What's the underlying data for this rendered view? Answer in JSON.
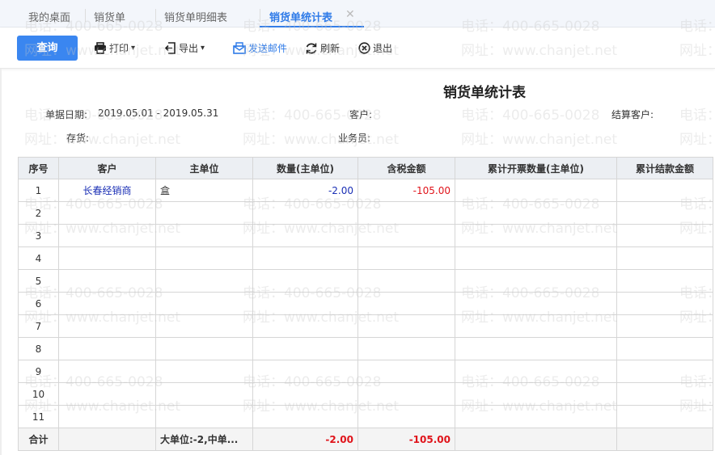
{
  "tabs": [
    "我的桌面",
    "销货单",
    "销货单明细表",
    "销货单统计表"
  ],
  "toolbar": {
    "query": "查询",
    "print": "打印",
    "export": "导出",
    "email": "发送邮件",
    "refresh": "刷新",
    "exit": "退出"
  },
  "report": {
    "title": "销货单统计表",
    "filters": {
      "date_label": "单据日期:",
      "date_value": "2019.05.01 - 2019.05.31",
      "customer_label": "客户:",
      "settle_label": "结算客户:",
      "stock_label": "存货:",
      "salesman_label": "业务员:"
    }
  },
  "table": {
    "headers": [
      "序号",
      "客户",
      "主单位",
      "数量(主单位)",
      "含税金额",
      "累计开票数量(主单位)",
      "累计结款金额"
    ],
    "rows": [
      [
        "1",
        "长春经销商",
        "盒",
        "-2.00",
        "-105.00",
        "",
        ""
      ],
      [
        "2",
        "",
        "",
        "",
        "",
        "",
        ""
      ],
      [
        "3",
        "",
        "",
        "",
        "",
        "",
        ""
      ],
      [
        "4",
        "",
        "",
        "",
        "",
        "",
        ""
      ],
      [
        "5",
        "",
        "",
        "",
        "",
        "",
        ""
      ],
      [
        "6",
        "",
        "",
        "",
        "",
        "",
        ""
      ],
      [
        "7",
        "",
        "",
        "",
        "",
        "",
        ""
      ],
      [
        "8",
        "",
        "",
        "",
        "",
        "",
        ""
      ],
      [
        "9",
        "",
        "",
        "",
        "",
        "",
        ""
      ],
      [
        "10",
        "",
        "",
        "",
        "",
        "",
        ""
      ],
      [
        "11",
        "",
        "",
        "",
        "",
        "",
        ""
      ]
    ],
    "footer": [
      "合计",
      "",
      "大单位:-2,中单...",
      "-2.00",
      "-105.00",
      "",
      ""
    ]
  },
  "watermark": {
    "phone": "电话：400-665-0028",
    "site": "网址：www.chanjet.net"
  },
  "colors": {
    "accent": "#3a86f0",
    "negative": "#e0141b",
    "link": "#1a2fb5"
  }
}
